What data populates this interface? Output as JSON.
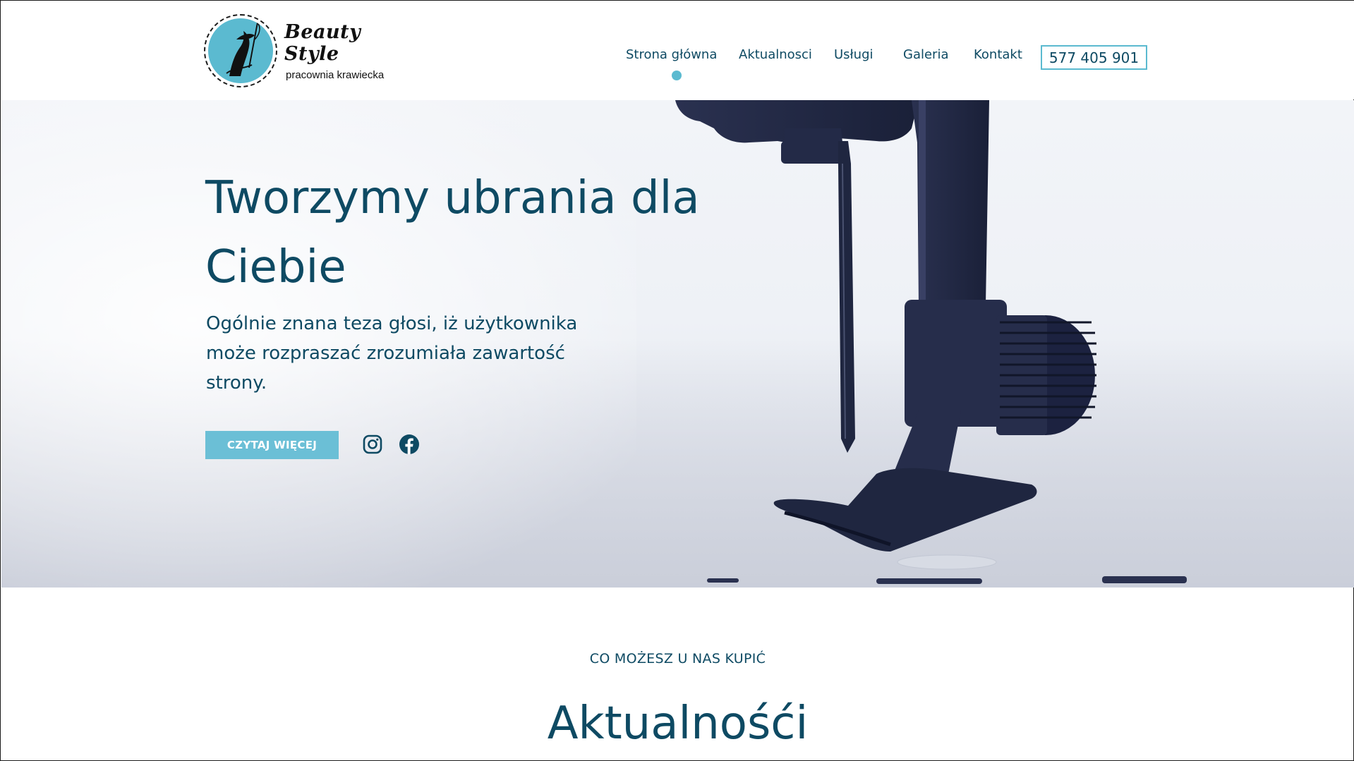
{
  "brand": {
    "name": "Beauty Style",
    "tagline": "pracownia krawiecka"
  },
  "nav": {
    "items": [
      {
        "label": "Strona główna",
        "active": true
      },
      {
        "label": "Aktualnosci"
      },
      {
        "label": "Usługi"
      },
      {
        "label": "Galeria"
      },
      {
        "label": "Kontakt"
      }
    ],
    "phone": "577 405 901"
  },
  "hero": {
    "title_line1": "Tworzymy ubrania dla",
    "title_line2": "Ciebie",
    "text_line1": "Ogólnie znana teza głosi, iż użytkownika",
    "text_line2": "może rozpraszać zrozumiała zawartość",
    "text_line3": "strony.",
    "cta": "CZYTAJ WIĘCEJ",
    "social_icons": [
      "instagram-icon",
      "facebook-icon"
    ]
  },
  "section": {
    "eyebrow": "CO MOŻESZ U NAS KUPIĆ",
    "title": "Aktualnośći"
  },
  "colors": {
    "accent": "#5bbad0",
    "text": "#0e4a63",
    "machine": "#1e2541"
  }
}
